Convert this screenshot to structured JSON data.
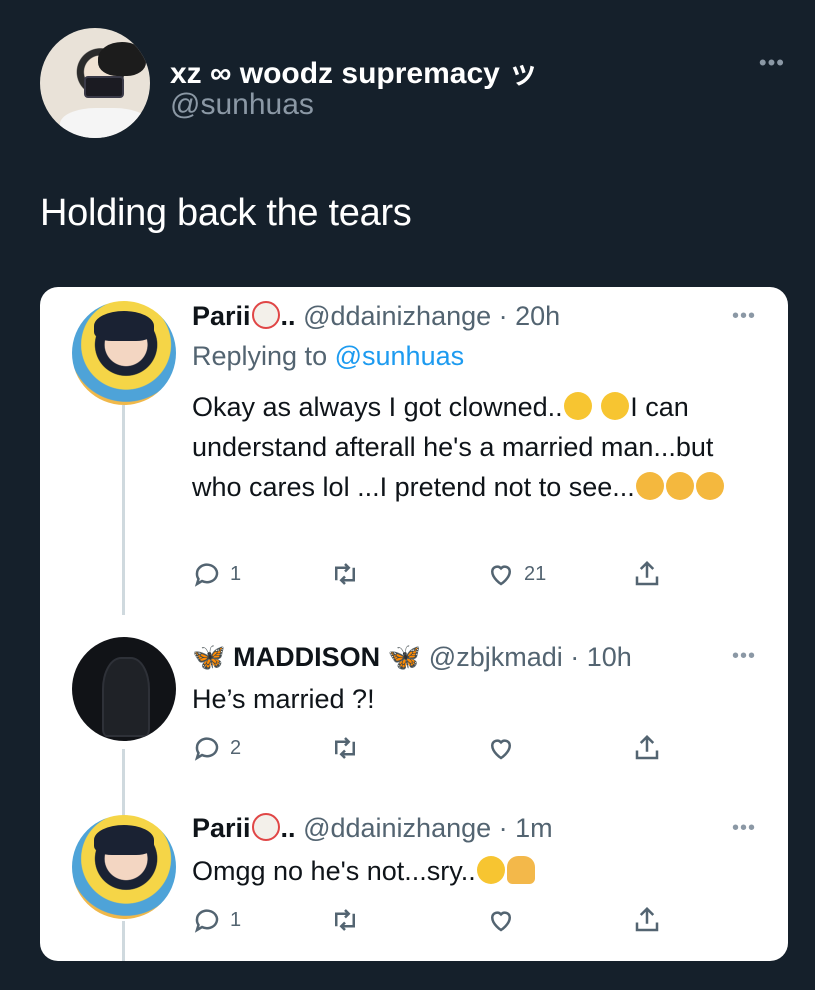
{
  "header": {
    "display_name": "xz ∞ woodz supremacy ッ",
    "handle": "@sunhuas",
    "more": "•••"
  },
  "tweet": {
    "text": "Holding back the tears"
  },
  "replies": [
    {
      "name": "Parii",
      "dots": "..",
      "handle": "@ddainizhange",
      "time": "· 20h",
      "replying_label": "Replying to",
      "replying_to": "@sunhuas",
      "text_1": "Okay as always I got clowned..",
      "text_2": "I can understand afterall he's a married man...but who cares lol ...I pretend not to see...",
      "reply_count": "1",
      "like_count": "21",
      "more": "•••"
    },
    {
      "butterfly": "🦋",
      "name": "MADDISON",
      "handle": "@zbjkmadi",
      "time": "· 10h",
      "text": "He’s married ?!",
      "reply_count": "2",
      "more": "•••"
    },
    {
      "name": "Parii",
      "dots": "..",
      "handle": "@ddainizhange",
      "time": "· 1m",
      "text": "Omgg no he's not...sry..",
      "reply_count": "1",
      "more": "•••"
    }
  ],
  "colors": {
    "background": "#15202b",
    "card": "#ffffff",
    "secondary_text": "#536471",
    "accent": "#1d9bf0"
  },
  "icons": [
    "reply-icon",
    "retweet-icon",
    "like-icon",
    "share-icon",
    "more-icon"
  ]
}
